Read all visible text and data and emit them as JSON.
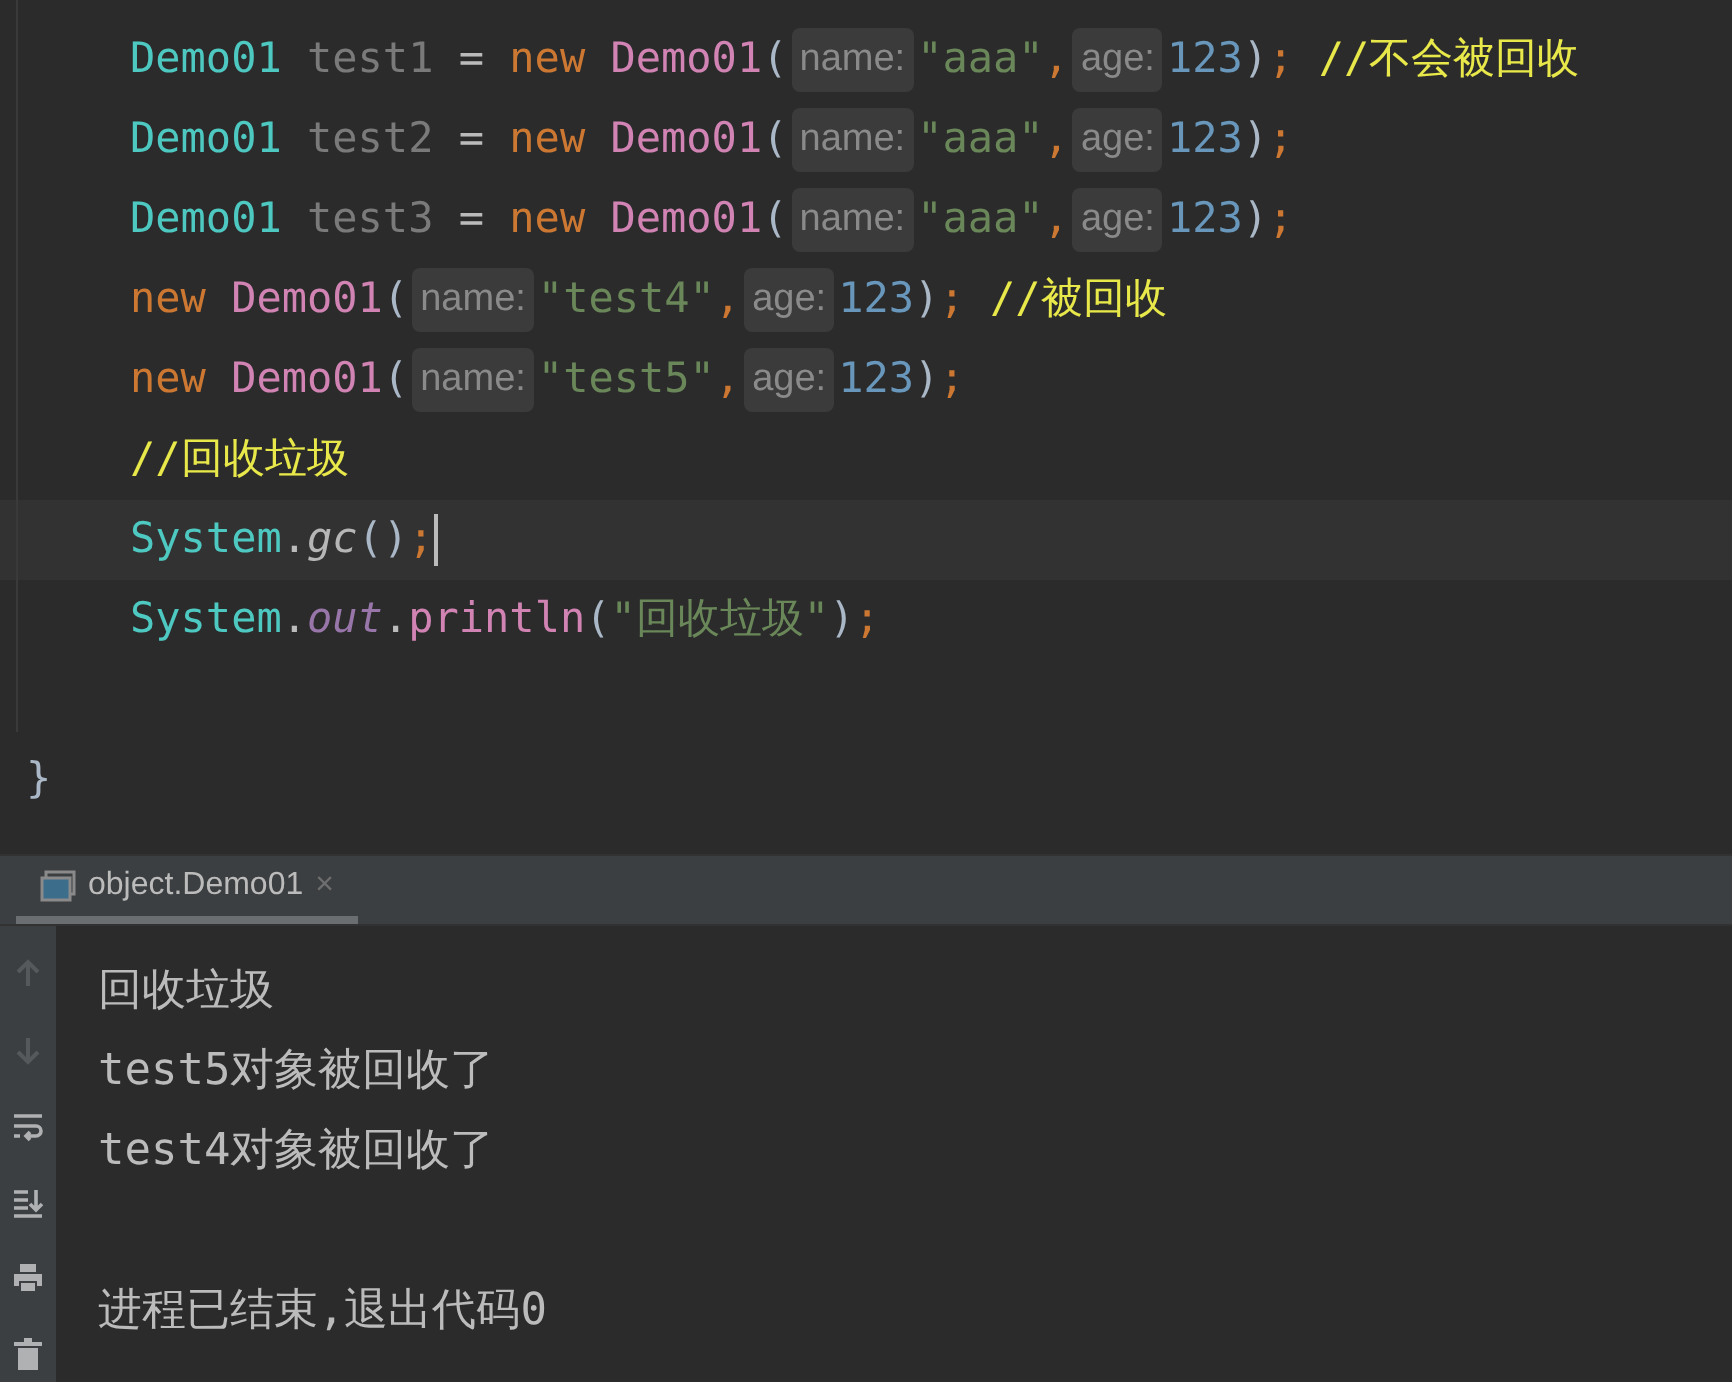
{
  "editor": {
    "lines": [
      {
        "current": false,
        "tokens": [
          {
            "kind": "type",
            "text": "Demo01"
          },
          {
            "kind": "var",
            "text": " test1"
          },
          {
            "kind": "op",
            "text": " = "
          },
          {
            "kind": "keyword",
            "text": "new"
          },
          {
            "kind": "ctor",
            "text": " Demo01"
          },
          {
            "kind": "paren",
            "text": "("
          },
          {
            "kind": "hint",
            "text": "name:"
          },
          {
            "kind": "string",
            "text": "\"aaa\""
          },
          {
            "kind": "punct",
            "text": ","
          },
          {
            "kind": "hint",
            "text": "age:"
          },
          {
            "kind": "number",
            "text": "123"
          },
          {
            "kind": "paren",
            "text": ")"
          },
          {
            "kind": "punct",
            "text": "; "
          },
          {
            "kind": "comment",
            "text": "//不会被回收"
          }
        ]
      },
      {
        "current": false,
        "tokens": [
          {
            "kind": "type",
            "text": "Demo01"
          },
          {
            "kind": "var",
            "text": " test2"
          },
          {
            "kind": "op",
            "text": " = "
          },
          {
            "kind": "keyword",
            "text": "new"
          },
          {
            "kind": "ctor",
            "text": " Demo01"
          },
          {
            "kind": "paren",
            "text": "("
          },
          {
            "kind": "hint",
            "text": "name:"
          },
          {
            "kind": "string",
            "text": "\"aaa\""
          },
          {
            "kind": "punct",
            "text": ","
          },
          {
            "kind": "hint",
            "text": "age:"
          },
          {
            "kind": "number",
            "text": "123"
          },
          {
            "kind": "paren",
            "text": ")"
          },
          {
            "kind": "punct",
            "text": ";"
          }
        ]
      },
      {
        "current": false,
        "tokens": [
          {
            "kind": "type",
            "text": "Demo01"
          },
          {
            "kind": "var",
            "text": " test3"
          },
          {
            "kind": "op",
            "text": " = "
          },
          {
            "kind": "keyword",
            "text": "new"
          },
          {
            "kind": "ctor",
            "text": " Demo01"
          },
          {
            "kind": "paren",
            "text": "("
          },
          {
            "kind": "hint",
            "text": "name:"
          },
          {
            "kind": "string",
            "text": "\"aaa\""
          },
          {
            "kind": "punct",
            "text": ","
          },
          {
            "kind": "hint",
            "text": "age:"
          },
          {
            "kind": "number",
            "text": "123"
          },
          {
            "kind": "paren",
            "text": ")"
          },
          {
            "kind": "punct",
            "text": ";"
          }
        ]
      },
      {
        "current": false,
        "tokens": [
          {
            "kind": "keyword",
            "text": "new"
          },
          {
            "kind": "ctor",
            "text": " Demo01"
          },
          {
            "kind": "paren",
            "text": "("
          },
          {
            "kind": "hint",
            "text": "name:"
          },
          {
            "kind": "string",
            "text": "\"test4\""
          },
          {
            "kind": "punct",
            "text": ","
          },
          {
            "kind": "hint",
            "text": "age:"
          },
          {
            "kind": "number",
            "text": "123"
          },
          {
            "kind": "paren",
            "text": ")"
          },
          {
            "kind": "punct",
            "text": "; "
          },
          {
            "kind": "comment",
            "text": "//被回收"
          }
        ]
      },
      {
        "current": false,
        "tokens": [
          {
            "kind": "keyword",
            "text": "new"
          },
          {
            "kind": "ctor",
            "text": " Demo01"
          },
          {
            "kind": "paren",
            "text": "("
          },
          {
            "kind": "hint",
            "text": "name:"
          },
          {
            "kind": "string",
            "text": "\"test5\""
          },
          {
            "kind": "punct",
            "text": ","
          },
          {
            "kind": "hint",
            "text": "age:"
          },
          {
            "kind": "number",
            "text": "123"
          },
          {
            "kind": "paren",
            "text": ")"
          },
          {
            "kind": "punct",
            "text": ";"
          }
        ]
      },
      {
        "current": false,
        "tokens": [
          {
            "kind": "comment",
            "text": "//回收垃圾"
          }
        ]
      },
      {
        "current": true,
        "tokens": [
          {
            "kind": "type",
            "text": "System"
          },
          {
            "kind": "op",
            "text": "."
          },
          {
            "kind": "method",
            "text": "gc"
          },
          {
            "kind": "paren",
            "text": "()"
          },
          {
            "kind": "punct",
            "text": ";"
          }
        ]
      },
      {
        "current": false,
        "tokens": [
          {
            "kind": "type",
            "text": "System"
          },
          {
            "kind": "op",
            "text": "."
          },
          {
            "kind": "field",
            "text": "out"
          },
          {
            "kind": "op",
            "text": "."
          },
          {
            "kind": "ctor",
            "text": "println"
          },
          {
            "kind": "paren",
            "text": "("
          },
          {
            "kind": "string",
            "text": "\"回收垃圾\""
          },
          {
            "kind": "paren",
            "text": ")"
          },
          {
            "kind": "punct",
            "text": ";"
          }
        ]
      }
    ],
    "closing": "}"
  },
  "run_panel": {
    "tab": {
      "label": "object.Demo01",
      "selected": true,
      "close": "×"
    },
    "toolbar": [
      {
        "kind": "up",
        "disabled": true
      },
      {
        "kind": "down",
        "disabled": true
      },
      {
        "kind": "wrap",
        "disabled": false
      },
      {
        "kind": "scroll-end",
        "disabled": false
      },
      {
        "kind": "print",
        "disabled": false
      },
      {
        "kind": "trash",
        "disabled": false
      }
    ],
    "output": [
      "回收垃圾",
      "test5对象被回收了",
      "test4对象被回收了"
    ],
    "exit_message": "进程已结束,退出代码0"
  }
}
